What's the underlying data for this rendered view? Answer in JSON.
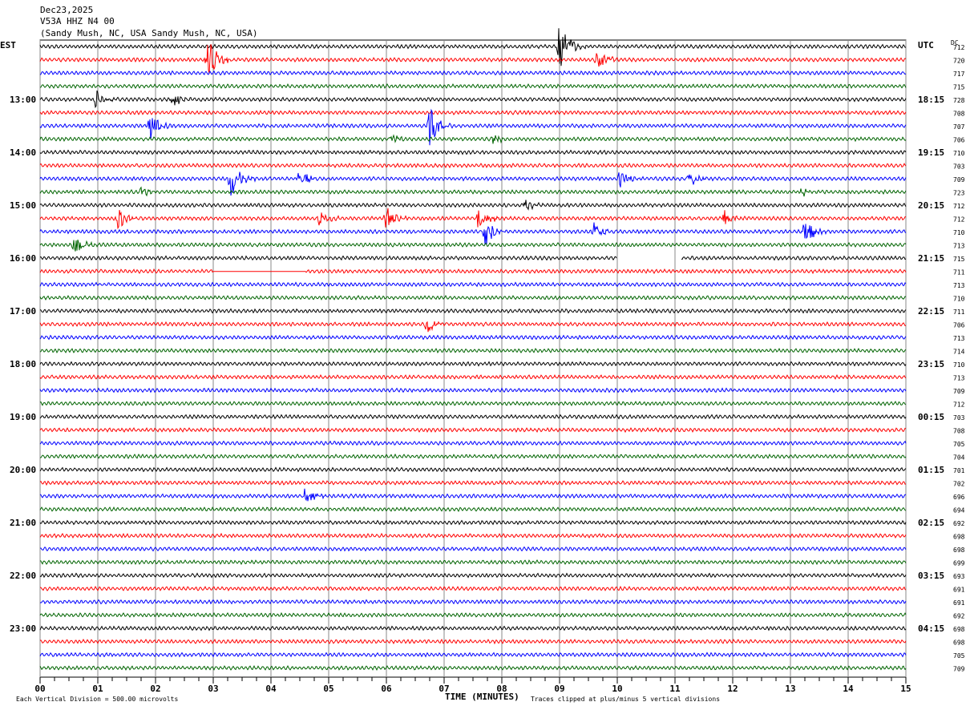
{
  "header": {
    "date": "Dec23,2025",
    "station": "V53A HHZ N4 00",
    "location": "(Sandy Mush, NC, USA Sandy Mush, NC, USA)"
  },
  "left_timezone": "EST",
  "right_timezone": "UTC",
  "dc_label": "DC",
  "footer": {
    "scale": "Each Vertical Division =  500.00 microvolts",
    "xlabel": "TIME (MINUTES)",
    "clip_note": "Traces clipped at plus/minus 5 vertical divisions"
  },
  "chart_data": {
    "type": "line",
    "subtype": "helicorder",
    "xlabel": "TIME (MINUTES)",
    "xlim": [
      0,
      15
    ],
    "x_ticks": [
      "00",
      "01",
      "02",
      "03",
      "04",
      "05",
      "06",
      "07",
      "08",
      "09",
      "10",
      "11",
      "12",
      "13",
      "14",
      "15"
    ],
    "minor_ticks_per_minute": 4,
    "grid": "vertical lines each minute",
    "trace_count": 48,
    "trace_colors": [
      "#000000",
      "#ff0000",
      "#0000ff",
      "#006400"
    ],
    "left_hour_labels": [
      "13:00",
      "14:00",
      "15:00",
      "16:00",
      "17:00",
      "18:00",
      "19:00",
      "20:00",
      "21:00",
      "22:00",
      "23:00"
    ],
    "right_hour_labels": [
      "18:15",
      "19:15",
      "20:15",
      "21:15",
      "22:15",
      "23:15",
      "00:15",
      "01:15",
      "02:15",
      "03:15",
      "04:15"
    ],
    "dc_offsets": [
      712,
      720,
      717,
      715,
      728,
      708,
      707,
      706,
      710,
      703,
      709,
      723,
      712,
      712,
      710,
      713,
      715,
      711,
      713,
      710,
      711,
      706,
      713,
      714,
      710,
      713,
      709,
      712,
      703,
      708,
      705,
      704,
      701,
      702,
      696,
      694,
      692,
      698,
      698,
      699,
      693,
      691,
      691,
      692,
      698,
      698,
      705,
      709
    ],
    "events": [
      {
        "trace": 0,
        "minute": 9.0,
        "amplitude_div": 5
      },
      {
        "trace": 1,
        "minute": 2.9,
        "amplitude_div": 4
      },
      {
        "trace": 1,
        "minute": 9.65,
        "amplitude_div": 1.5
      },
      {
        "trace": 4,
        "minute": 0.97,
        "amplitude_div": 1.2
      },
      {
        "trace": 4,
        "minute": 2.3,
        "amplitude_div": 1.2
      },
      {
        "trace": 6,
        "minute": 1.9,
        "amplitude_div": 2
      },
      {
        "trace": 6,
        "minute": 6.75,
        "amplitude_div": 3
      },
      {
        "trace": 7,
        "minute": 6.1,
        "amplitude_div": 0.8
      },
      {
        "trace": 7,
        "minute": 7.85,
        "amplitude_div": 0.6
      },
      {
        "trace": 10,
        "minute": 3.3,
        "amplitude_div": 3
      },
      {
        "trace": 10,
        "minute": 4.5,
        "amplitude_div": 1.5
      },
      {
        "trace": 10,
        "minute": 10.05,
        "amplitude_div": 1.2
      },
      {
        "trace": 10,
        "minute": 11.25,
        "amplitude_div": 1.2
      },
      {
        "trace": 11,
        "minute": 1.75,
        "amplitude_div": 0.8
      },
      {
        "trace": 11,
        "minute": 13.2,
        "amplitude_div": 0.7
      },
      {
        "trace": 12,
        "minute": 8.4,
        "amplitude_div": 0.8
      },
      {
        "trace": 13,
        "minute": 1.35,
        "amplitude_div": 1.5
      },
      {
        "trace": 13,
        "minute": 4.85,
        "amplitude_div": 1.2
      },
      {
        "trace": 13,
        "minute": 6.0,
        "amplitude_div": 1.5
      },
      {
        "trace": 13,
        "minute": 7.6,
        "amplitude_div": 2
      },
      {
        "trace": 13,
        "minute": 11.85,
        "amplitude_div": 1.5
      },
      {
        "trace": 14,
        "minute": 7.7,
        "amplitude_div": 2.5
      },
      {
        "trace": 14,
        "minute": 9.6,
        "amplitude_div": 1.2
      },
      {
        "trace": 14,
        "minute": 13.25,
        "amplitude_div": 2.2
      },
      {
        "trace": 15,
        "minute": 0.6,
        "amplitude_div": 1.5
      },
      {
        "trace": 21,
        "minute": 6.7,
        "amplitude_div": 1.3
      },
      {
        "trace": 34,
        "minute": 4.6,
        "amplitude_div": 1.3
      }
    ],
    "gaps": [
      {
        "trace": 16,
        "from_minute": 10.0,
        "to_minute": 11.1
      }
    ],
    "flat_segments": [
      {
        "trace": 17,
        "from_minute": 3.0,
        "to_minute": 4.6
      }
    ]
  }
}
